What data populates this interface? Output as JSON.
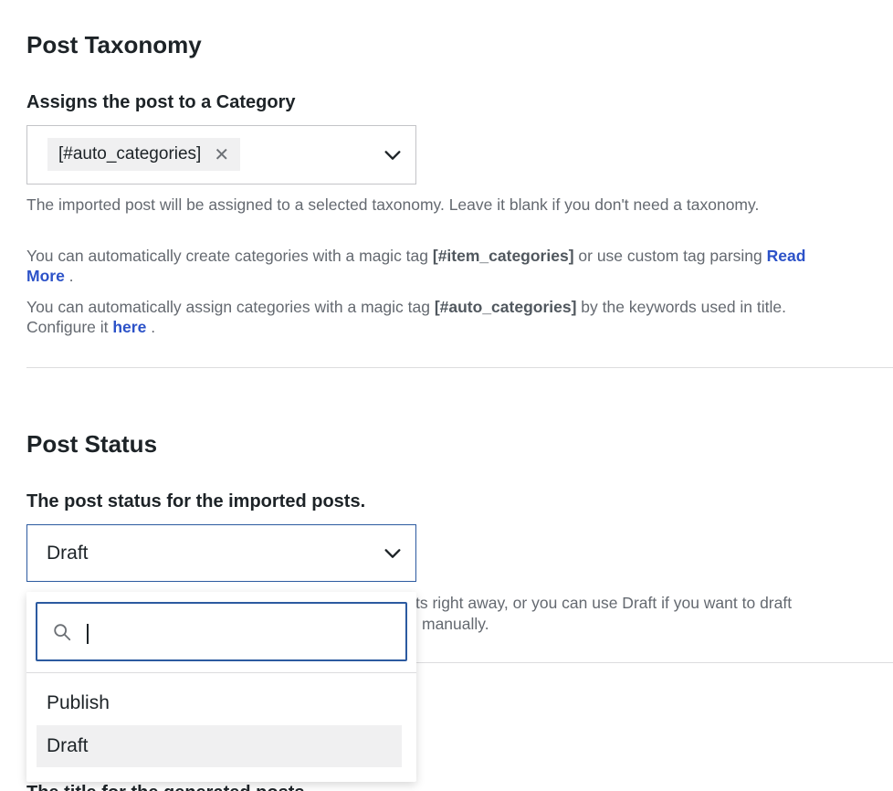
{
  "taxonomy": {
    "title": "Post Taxonomy",
    "label": "Assigns the post to a Category",
    "selected_tag": "[#auto_categories]",
    "remove_symbol": "✕",
    "help1": "The imported post will be assigned to a selected taxonomy. Leave it blank if you don't need a taxonomy.",
    "help2_prefix": "You can automatically create categories with a magic tag ",
    "help2_tag": "[#item_categories]",
    "help2_mid": " or use custom tag parsing ",
    "help2_link": "Read More",
    "help2_suffix": " .",
    "help3_prefix": "You can automatically assign categories with a magic tag ",
    "help3_tag": "[#auto_categories]",
    "help3_mid": " by the keywords used in title. Configure it ",
    "help3_link": "here",
    "help3_suffix": " ."
  },
  "status": {
    "title": "Post Status",
    "label": "The post status for the imported posts.",
    "selected_value": "Draft",
    "help_line1_visible": "ts right away, or you can use Draft if you want to draft",
    "help_line2_visible": "manually.",
    "dropdown": {
      "search_value": "",
      "search_placeholder": "",
      "options": [
        {
          "label": "Publish",
          "selected": false
        },
        {
          "label": "Draft",
          "selected": true
        }
      ]
    }
  },
  "next_section_partial_label": "The title for the generated posts",
  "icons": {
    "chevron": "chevron-down-icon",
    "search": "search-icon",
    "remove": "close-icon"
  },
  "colors": {
    "accent": "#2c5aa0",
    "link": "#2c52c8",
    "help_text": "#646970"
  }
}
